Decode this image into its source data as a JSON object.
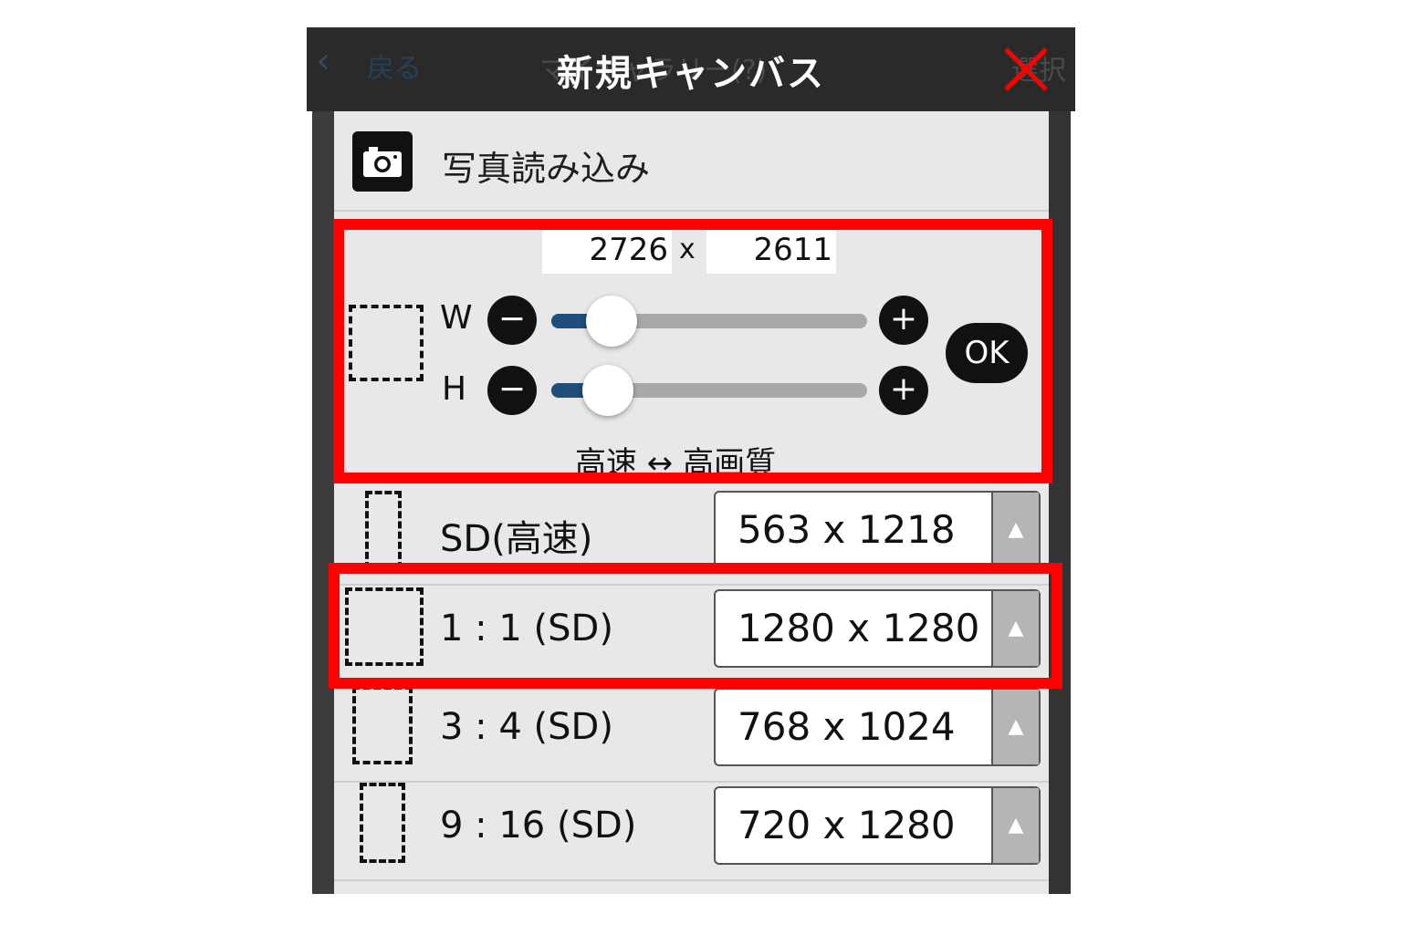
{
  "header": {
    "back_icon": "‹",
    "back_label": "戻る",
    "ghost_title": "マイギャラリー(?)",
    "ghost_right": "選択",
    "title": "新規キャンバス"
  },
  "photo": {
    "label": "写真読み込み"
  },
  "custom": {
    "width_value": "2726",
    "times": "x",
    "height_value": "2611",
    "w_label": "W",
    "h_label": "H",
    "minus": "−",
    "plus": "+",
    "w_slider_fraction": 0.19,
    "h_slider_fraction": 0.18,
    "ok_label": "OK",
    "quality_label": "高速 ↔ 高画質"
  },
  "presets": [
    {
      "label": "SD(高速)",
      "value": "563 x 1218"
    },
    {
      "label": "1 : 1 (SD)",
      "value": "1280 x 1280"
    },
    {
      "label": "3 : 4 (SD)",
      "value": "768 x 1024"
    },
    {
      "label": "9 : 16 (SD)",
      "value": "720 x 1280"
    }
  ],
  "select_arrow": "▲",
  "colors": {
    "highlight_red": "#ff0000",
    "slider_fill": "#1f4e7a",
    "titlebar": "#2a2a2a"
  }
}
